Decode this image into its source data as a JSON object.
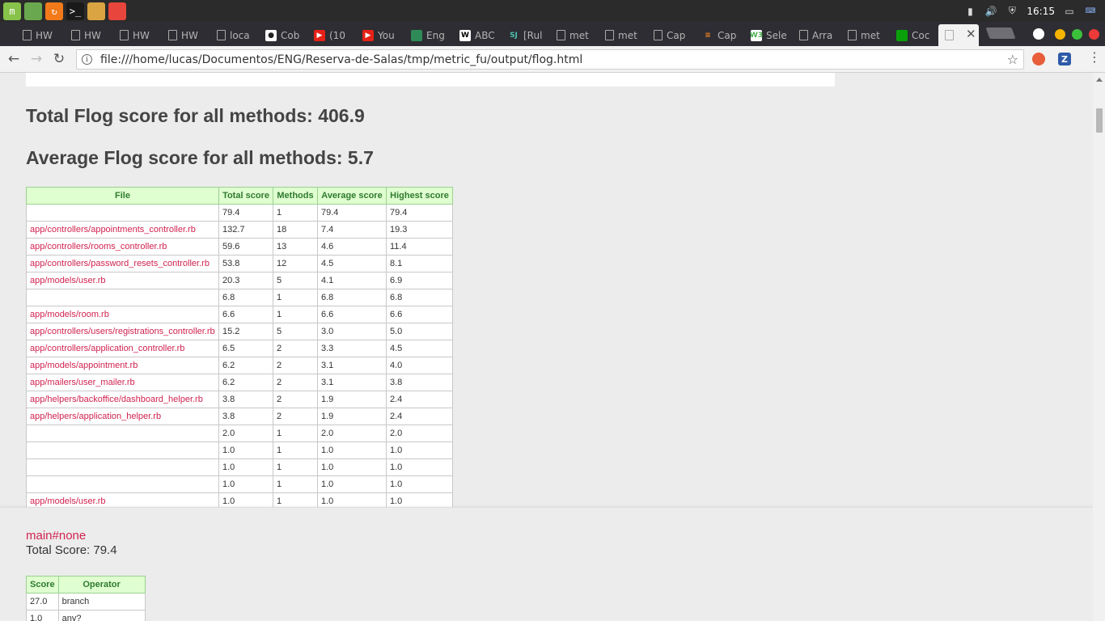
{
  "os_panel": {
    "launchers": [
      {
        "name": "mint-menu-icon",
        "glyph": "m",
        "color": "#87c34a"
      },
      {
        "name": "files-icon",
        "glyph": "",
        "color": "#6aa84f"
      },
      {
        "name": "firefox-icon",
        "glyph": "↻",
        "color": "#f27a1a"
      },
      {
        "name": "terminal-icon",
        "glyph": ">_",
        "color": "#1a1a1a"
      },
      {
        "name": "folder-icon",
        "glyph": "",
        "color": "#d9a441"
      },
      {
        "name": "chrome-icon",
        "glyph": "",
        "color": "#e8453c"
      }
    ],
    "clock": "16:15"
  },
  "tabs": [
    {
      "title": "HW",
      "icon": "document-icon"
    },
    {
      "title": "HW",
      "icon": "document-icon"
    },
    {
      "title": "HW",
      "icon": "document-icon"
    },
    {
      "title": "HW",
      "icon": "document-icon"
    },
    {
      "title": "loca",
      "icon": "document-icon"
    },
    {
      "title": "Cob",
      "icon": "github-icon"
    },
    {
      "title": "(10",
      "icon": "youtube-icon"
    },
    {
      "title": "You",
      "icon": "youtube-icon"
    },
    {
      "title": "Eng",
      "icon": "flag-icon"
    },
    {
      "title": "ABC",
      "icon": "wikipedia-icon"
    },
    {
      "title": "[Rul",
      "icon": "sj-icon"
    },
    {
      "title": "met",
      "icon": "document-icon"
    },
    {
      "title": "met",
      "icon": "document-icon"
    },
    {
      "title": "Cap",
      "icon": "document-icon"
    },
    {
      "title": "Cap",
      "icon": "stackoverflow-icon"
    },
    {
      "title": "Sele",
      "icon": "w3schools-icon"
    },
    {
      "title": "Arra",
      "icon": "document-icon"
    },
    {
      "title": "met",
      "icon": "document-icon"
    },
    {
      "title": "Coc",
      "icon": "green-square-icon"
    },
    {
      "title": "",
      "icon": "document-icon"
    }
  ],
  "toolbar": {
    "url": "file:///home/lucas/Documentos/ENG/Reserva-de-Salas/tmp/metric_fu/output/flog.html"
  },
  "page": {
    "total_heading": "Total Flog score for all methods: 406.9",
    "average_heading": "Average Flog score for all methods: 5.7",
    "file_table": {
      "headers": [
        "File",
        "Total score",
        "Methods",
        "Average score",
        "Highest score"
      ],
      "rows": [
        {
          "file": "",
          "total": "79.4",
          "methods": "1",
          "average": "79.4",
          "highest": "79.4"
        },
        {
          "file": "app/controllers/appointments_controller.rb",
          "total": "132.7",
          "methods": "18",
          "average": "7.4",
          "highest": "19.3"
        },
        {
          "file": "app/controllers/rooms_controller.rb",
          "total": "59.6",
          "methods": "13",
          "average": "4.6",
          "highest": "11.4"
        },
        {
          "file": "app/controllers/password_resets_controller.rb",
          "total": "53.8",
          "methods": "12",
          "average": "4.5",
          "highest": "8.1"
        },
        {
          "file": "app/models/user.rb",
          "total": "20.3",
          "methods": "5",
          "average": "4.1",
          "highest": "6.9"
        },
        {
          "file": "",
          "total": "6.8",
          "methods": "1",
          "average": "6.8",
          "highest": "6.8"
        },
        {
          "file": "app/models/room.rb",
          "total": "6.6",
          "methods": "1",
          "average": "6.6",
          "highest": "6.6"
        },
        {
          "file": "app/controllers/users/registrations_controller.rb",
          "total": "15.2",
          "methods": "5",
          "average": "3.0",
          "highest": "5.0"
        },
        {
          "file": "app/controllers/application_controller.rb",
          "total": "6.5",
          "methods": "2",
          "average": "3.3",
          "highest": "4.5"
        },
        {
          "file": "app/models/appointment.rb",
          "total": "6.2",
          "methods": "2",
          "average": "3.1",
          "highest": "4.0"
        },
        {
          "file": "app/mailers/user_mailer.rb",
          "total": "6.2",
          "methods": "2",
          "average": "3.1",
          "highest": "3.8"
        },
        {
          "file": "app/helpers/backoffice/dashboard_helper.rb",
          "total": "3.8",
          "methods": "2",
          "average": "1.9",
          "highest": "2.4"
        },
        {
          "file": "app/helpers/application_helper.rb",
          "total": "3.8",
          "methods": "2",
          "average": "1.9",
          "highest": "2.4"
        },
        {
          "file": "",
          "total": "2.0",
          "methods": "1",
          "average": "2.0",
          "highest": "2.0"
        },
        {
          "file": "",
          "total": "1.0",
          "methods": "1",
          "average": "1.0",
          "highest": "1.0"
        },
        {
          "file": "",
          "total": "1.0",
          "methods": "1",
          "average": "1.0",
          "highest": "1.0"
        },
        {
          "file": "",
          "total": "1.0",
          "methods": "1",
          "average": "1.0",
          "highest": "1.0"
        },
        {
          "file": "app/models/user.rb",
          "total": "1.0",
          "methods": "1",
          "average": "1.0",
          "highest": "1.0"
        }
      ]
    },
    "detail": {
      "method_name": "main#none",
      "total_score": "Total Score: 79.4",
      "operator_table": {
        "headers": [
          "Score",
          "Operator"
        ],
        "rows": [
          {
            "score": "27.0",
            "operator": "branch"
          },
          {
            "score": "1.0",
            "operator": "any?"
          }
        ]
      }
    }
  },
  "colors": {
    "link": "#d1234f",
    "header_bg": "#dfffd0",
    "header_text": "#2f7a2f"
  }
}
